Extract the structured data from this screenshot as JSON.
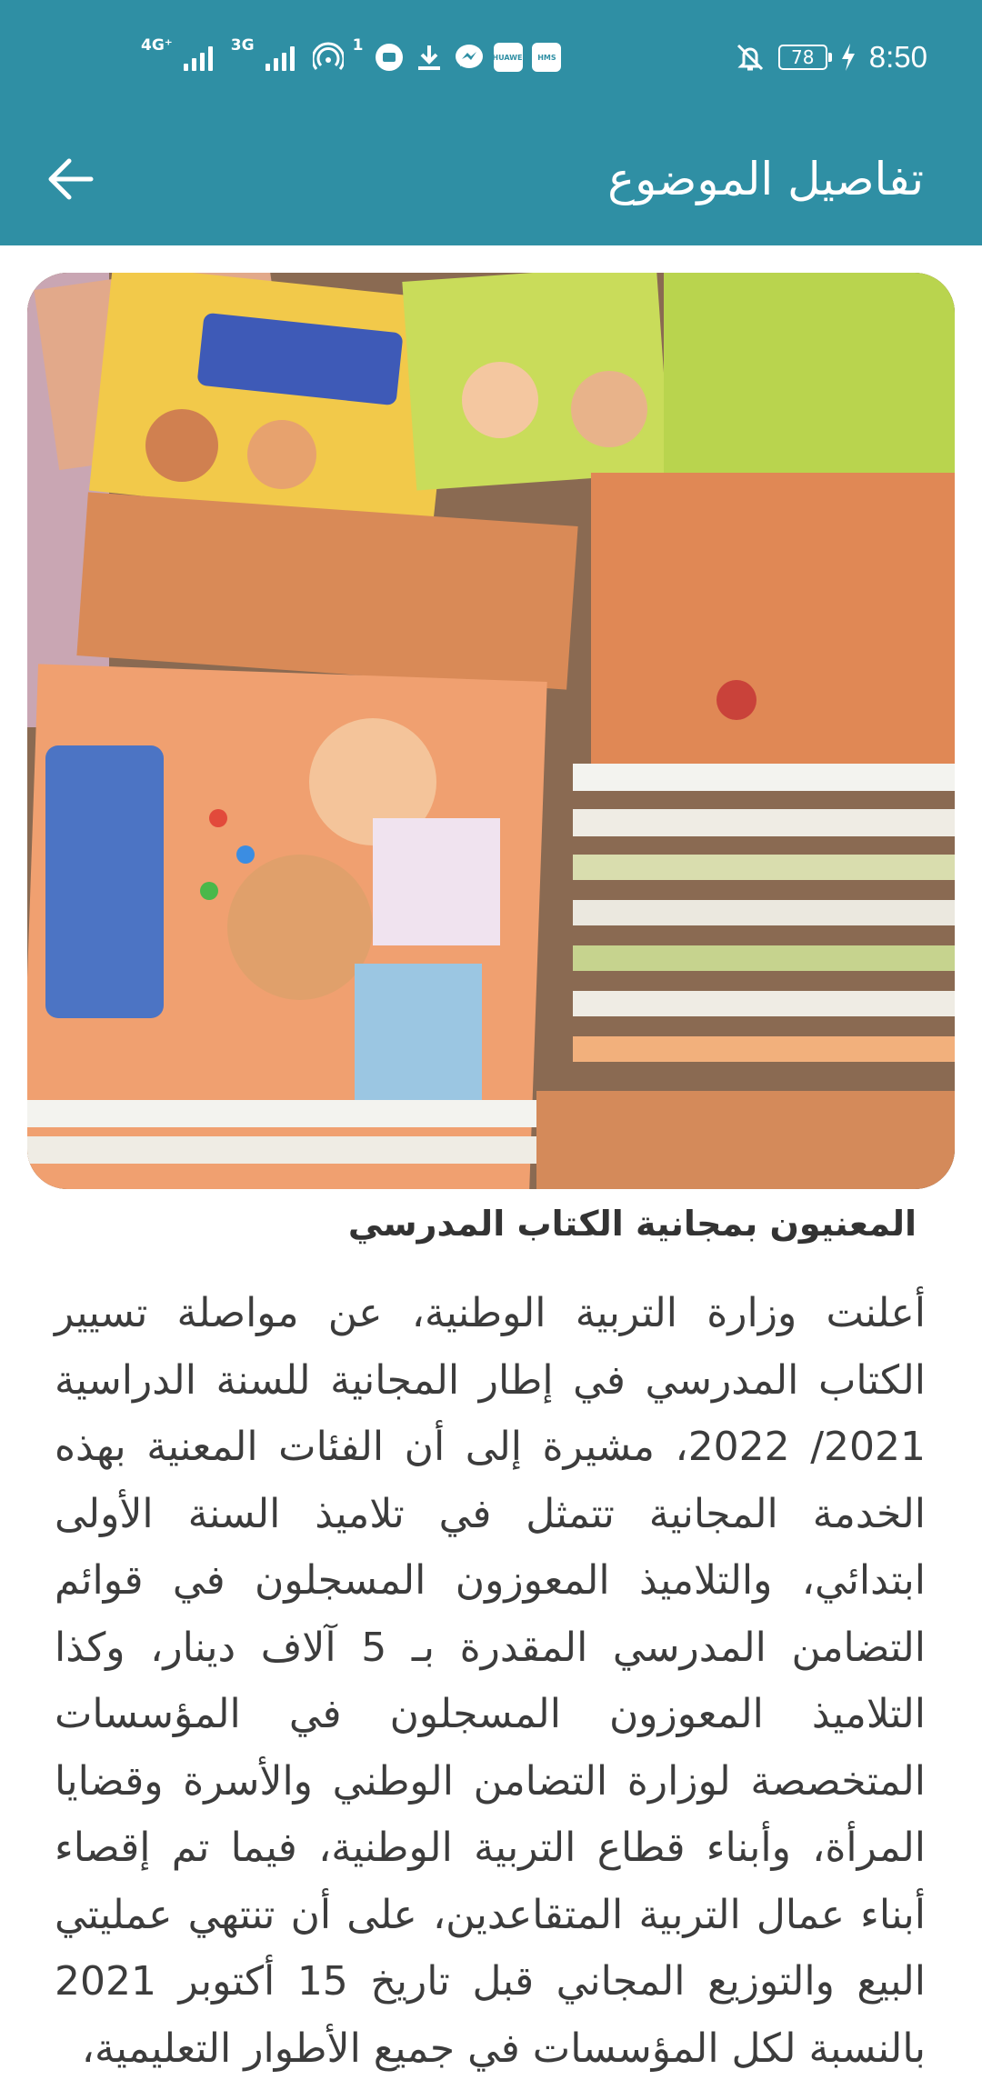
{
  "status_bar": {
    "network_1": "4G⁺",
    "network_2": "3G",
    "hotspot_count": "1",
    "app_label_1": "HUAWEI",
    "app_label_2": "HMS",
    "battery_level": "78",
    "time": "8:50"
  },
  "app_bar": {
    "title": "تفاصيل الموضوع",
    "back_icon": "arrow-left-icon"
  },
  "article": {
    "image_description_icon": "school-textbooks-photo",
    "heading": "المعنيون بمجانية الكتاب المدرسي",
    "body": "أعلنت وزارة التربية الوطنية، عن مواصلة تسيير الكتاب المدرسي في إطار المجانية للسنة الدراسية 2021/ 2022، مشيرة إلى أن الفئات المعنية بهذه الخدمة المجانية تتمثل في تلاميذ السنة الأولى ابتدائي، والتلاميذ المعوزون المسجلون في قوائم التضامن المدرسي المقدرة بـ 5 آلاف دينار، وكذا التلاميذ المعوزون المسجلون في المؤسسات المتخصصة لوزارة التضامن الوطني والأسرة وقضايا المرأة، وأبناء قطاع التربية الوطنية، فيما تم إقصاء أبناء عمال التربية المتقاعدين، على أن تنتهي عمليتي البيع والتوزيع المجاني قبل تاريخ 15 أكتوبر 2021 بالنسبة لكل المؤسسات في جميع الأطوار التعليمية،"
  },
  "colors": {
    "header": "#2f8fa4",
    "text": "#3c3c3c",
    "heading": "#333333"
  }
}
